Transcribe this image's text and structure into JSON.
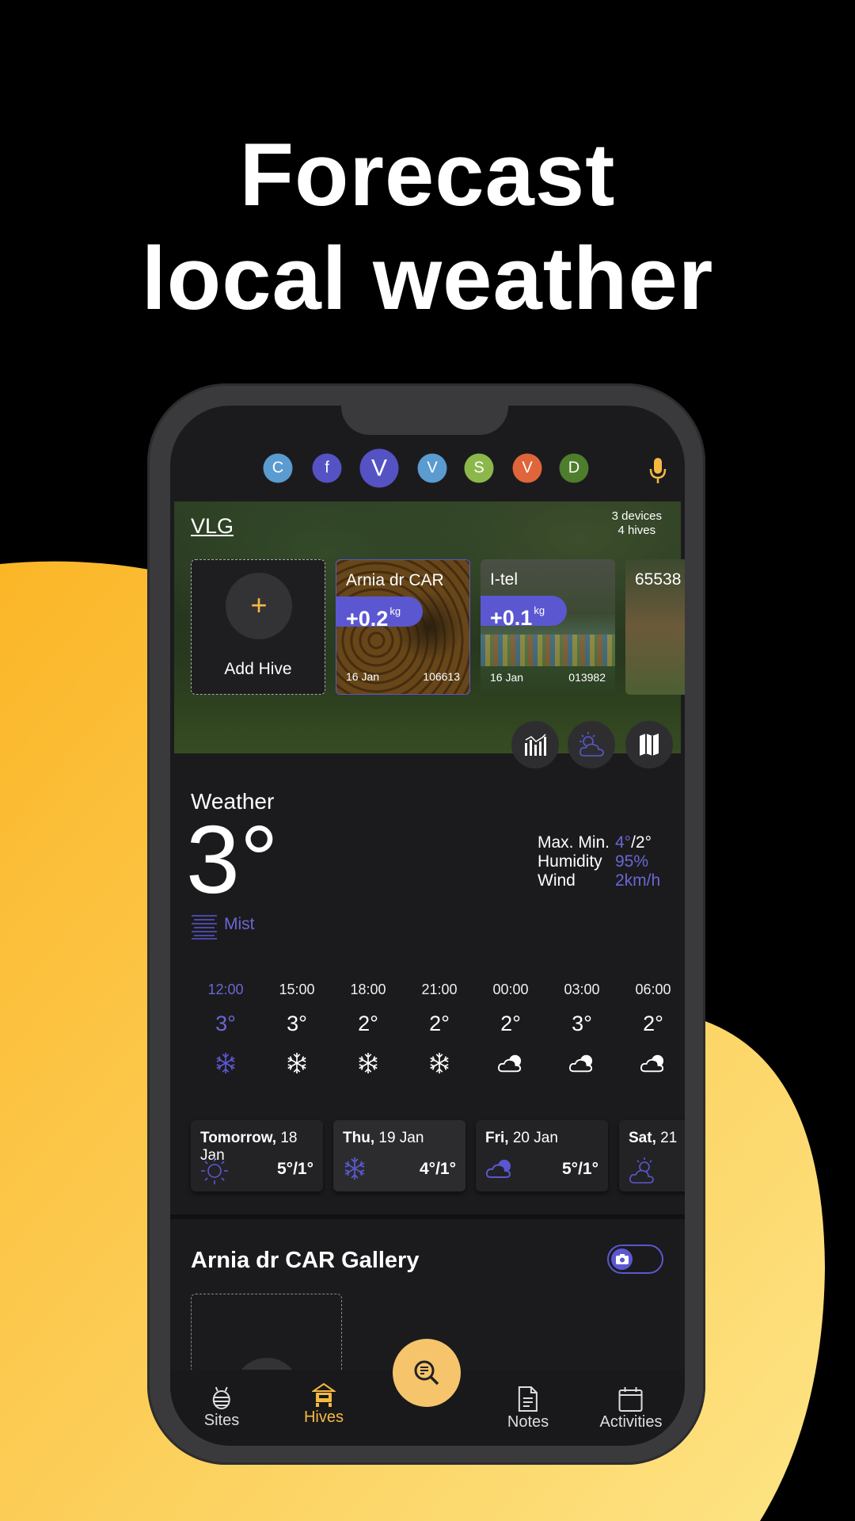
{
  "headline": {
    "line1": "Forecast",
    "line2": "local weather"
  },
  "colors": {
    "accent": "#5b57d1",
    "yellow": "#f6c46b",
    "active_nav": "#f5b942",
    "bg_yellow_start": "#fbb627",
    "bg_yellow_end": "#fde485"
  },
  "avatars": [
    {
      "letter": "C",
      "color": "#5a9bd0"
    },
    {
      "letter": "f",
      "color": "#5552c4"
    },
    {
      "letter": "V",
      "color": "#5552c4",
      "selected": true
    },
    {
      "letter": "V",
      "color": "#5a9bd0"
    },
    {
      "letter": "S",
      "color": "#8cb84b"
    },
    {
      "letter": "V",
      "color": "#e0653b"
    },
    {
      "letter": "D",
      "color": "#4e7d2c"
    }
  ],
  "mic_icon": "microphone-icon",
  "site": {
    "name": "VLG",
    "devices": "3 devices",
    "hives": "4 hives"
  },
  "hives": {
    "add_label": "Add Hive",
    "cards": [
      {
        "name": "Arnia dr CAR",
        "weight": "+0.2",
        "unit": "kg",
        "date": "16 Jan",
        "id": "106613"
      },
      {
        "name": "I-tel",
        "weight": "+0.1",
        "unit": "kg",
        "date": "16 Jan",
        "id": "013982"
      },
      {
        "name": "65538"
      }
    ]
  },
  "actions": [
    "chart-icon",
    "weather-icon",
    "map-icon"
  ],
  "weather": {
    "title": "Weather",
    "temp": "3°",
    "condition": "Mist",
    "stats": [
      {
        "label": "Max. Min.",
        "value_a": "4°",
        "value_b": "/2°"
      },
      {
        "label": "Humidity",
        "value_a": "95%",
        "value_b": ""
      },
      {
        "label": "Wind",
        "value_a": "2km/h",
        "value_b": ""
      }
    ],
    "hourly": [
      {
        "time": "12:00",
        "temp": "3°",
        "icon": "snow",
        "active": true
      },
      {
        "time": "15:00",
        "temp": "3°",
        "icon": "snow"
      },
      {
        "time": "18:00",
        "temp": "2°",
        "icon": "snow"
      },
      {
        "time": "21:00",
        "temp": "2°",
        "icon": "snow"
      },
      {
        "time": "00:00",
        "temp": "2°",
        "icon": "cloud"
      },
      {
        "time": "03:00",
        "temp": "3°",
        "icon": "cloud"
      },
      {
        "time": "06:00",
        "temp": "2°",
        "icon": "cloud"
      }
    ],
    "daily": [
      {
        "day": "Tomorrow,",
        "date": " 18 Jan",
        "temp": "5°/1°",
        "icon": "sun"
      },
      {
        "day": "Thu,",
        "date": " 19 Jan",
        "temp": "4°/1°",
        "icon": "snow",
        "selected": true
      },
      {
        "day": "Fri,",
        "date": " 20 Jan",
        "temp": "5°/1°",
        "icon": "cloud"
      },
      {
        "day": "Sat,",
        "date": " 21",
        "temp": "",
        "icon": "partly-cloudy"
      }
    ]
  },
  "gallery": {
    "title": "Arnia dr CAR Gallery"
  },
  "nav": [
    {
      "label": "Sites",
      "icon": "bee-icon"
    },
    {
      "label": "Hives",
      "icon": "hive-icon",
      "active": true
    },
    {
      "label": "Notes",
      "icon": "note-icon"
    },
    {
      "label": "Activities",
      "icon": "calendar-icon"
    }
  ]
}
